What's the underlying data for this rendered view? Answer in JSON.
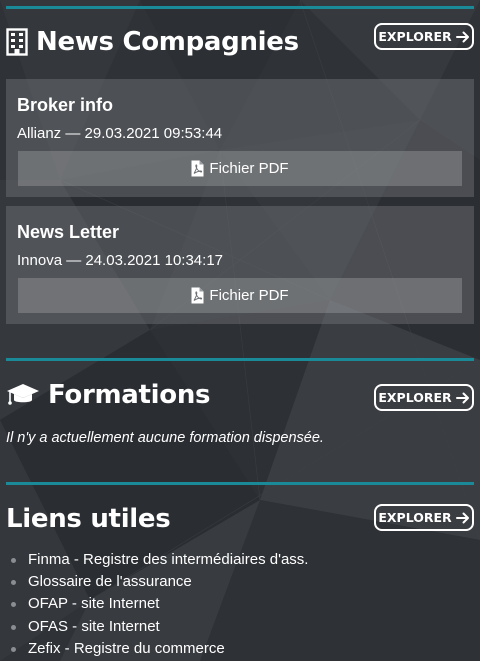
{
  "colors": {
    "accent": "#1a8a99",
    "background": "#2f3237"
  },
  "news": {
    "title": "News Compagnies",
    "icon": "building-icon",
    "explore_label": "EXPLORER",
    "items": [
      {
        "title": "Broker info",
        "meta": "Allianz — 29.03.2021 09:53:44",
        "pdf_label": "Fichier PDF"
      },
      {
        "title": "News Letter",
        "meta": "Innova — 24.03.2021 10:34:17",
        "pdf_label": "Fichier PDF"
      }
    ]
  },
  "formations": {
    "title": "Formations",
    "icon": "graduation-cap-icon",
    "explore_label": "EXPLORER",
    "empty_message": "Il n'y a actuellement aucune formation dispensée."
  },
  "links": {
    "title": "Liens utiles",
    "explore_label": "EXPLORER",
    "items": [
      "Finma - Registre des intermédiaires d'ass.",
      "Glossaire de l'assurance",
      "OFAP - site Internet",
      "OFAS - site Internet",
      "Zefix - Registre du commerce"
    ]
  }
}
